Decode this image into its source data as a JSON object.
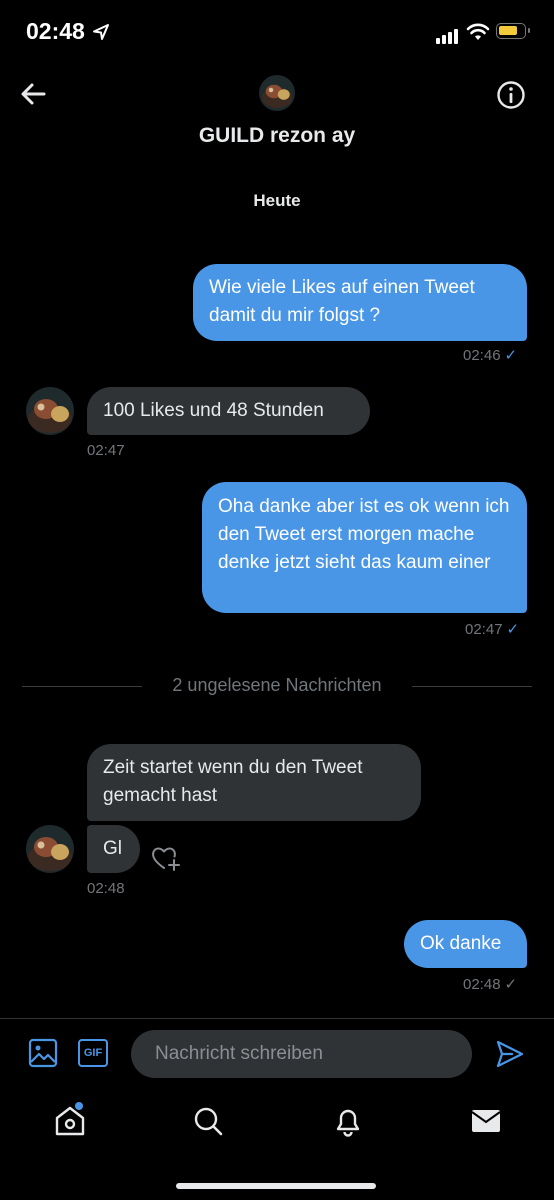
{
  "status_bar": {
    "time": "02:48"
  },
  "header": {
    "title": "GUILD rezon ay",
    "date_label": "Heute"
  },
  "messages": [
    {
      "text": "Wie viele Likes auf einen Tweet damit du mir folgst ?",
      "time": "02:46",
      "direction": "sent",
      "check": "✓"
    },
    {
      "text": "100 Likes und 48 Stunden",
      "time": "02:47",
      "direction": "received"
    },
    {
      "text": "Oha danke aber ist es ok wenn ich den Tweet erst morgen mache denke jetzt sieht das kaum einer",
      "time": "02:47",
      "direction": "sent",
      "check": "✓"
    },
    {
      "text": "Zeit startet wenn du den Tweet gemacht hast",
      "direction": "received"
    },
    {
      "text": "Gl",
      "time": "02:48",
      "direction": "received"
    },
    {
      "text": "Ok danke",
      "time": "02:48",
      "direction": "sent",
      "check": "✓"
    }
  ],
  "unread_divider": "2 ungelesene Nachrichten",
  "composer": {
    "placeholder": "Nachricht schreiben",
    "gif_label": "GIF"
  },
  "tabs": [
    "home-icon",
    "search-icon",
    "bell-icon",
    "mail-icon"
  ],
  "colors": {
    "accent": "#4a96e6",
    "received_bubble": "#2f3336",
    "background": "#000000"
  }
}
